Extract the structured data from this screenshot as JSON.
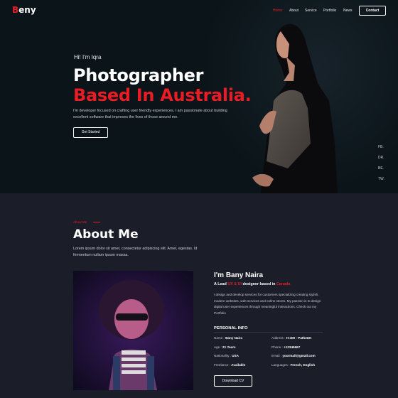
{
  "brand": {
    "initial": "B",
    "rest": "eny"
  },
  "nav": {
    "items": [
      {
        "label": "Home"
      },
      {
        "label": "About"
      },
      {
        "label": "Service"
      },
      {
        "label": "Portfolio"
      },
      {
        "label": "News"
      }
    ],
    "contact_label": "Contact"
  },
  "hero": {
    "greeting": "Hi! I'm Iqra",
    "title_line1": "Photographer",
    "title_line2": "Based In Australia.",
    "intro": "I'm developer focused on crafting user friendly experiences, I am passionate about building excellent software that improves the lives of those around me.",
    "cta_label": "Get Started"
  },
  "social": [
    "FB.",
    "DR.",
    "BE.",
    "TW."
  ],
  "about": {
    "subtitle": "About Me",
    "title": "About Me",
    "description": "Lorem ipsum dolor sit amet, consectetur adipiscing elit. Amet, egestas. Id fermentum nullam ipsum massa.",
    "name": "I'm Bany Naira",
    "tagline_prefix": "A Lead ",
    "tagline_role": "UX & UI",
    "tagline_middle": " designer based in ",
    "tagline_place": "Canada",
    "bio": "I design and develop services for customers specializing creating stylish, modern websites, web services and online stores. My passion is to design digital user experiences through meaningful interactions. Check out my Portfolio",
    "personal_info_title": "PERSONAL INFO",
    "info_left": [
      {
        "label": "Name : ",
        "value": "Bany Naira"
      },
      {
        "label": "Age : ",
        "value": "21 Years"
      },
      {
        "label": "Nationality : ",
        "value": "USA"
      },
      {
        "label": "Freelance : ",
        "value": "Available"
      }
    ],
    "info_right": [
      {
        "label": "Address : ",
        "value": "H-400 - Path2UK"
      },
      {
        "label": "Phone : ",
        "value": "+12345667"
      },
      {
        "label": "Email : ",
        "value": "yourmail@gmail.com"
      },
      {
        "label": "Languages : ",
        "value": "French, English"
      }
    ],
    "cv_label": "Download CV"
  },
  "colors": {
    "accent": "#e81c24",
    "hero_bg": "#0a1419",
    "section_bg": "#1b1d29"
  }
}
